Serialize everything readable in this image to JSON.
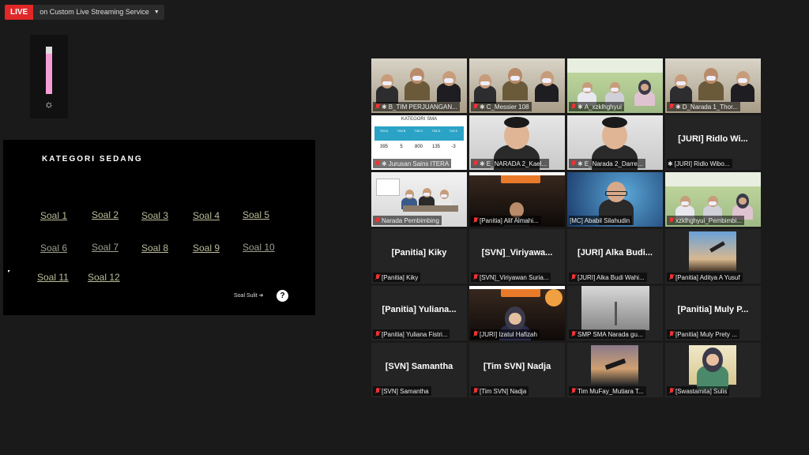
{
  "live": {
    "badge": "LIVE",
    "service": "on Custom Live Streaming Service",
    "caret": "▼"
  },
  "mic": {
    "level_percent": 85,
    "icon": "brightness-icon"
  },
  "share": {
    "title": "KATEGORI SEDANG",
    "questions": [
      "Soal 1",
      "Soal 2",
      "Soal 3",
      "Soal 4",
      "Soal 5",
      "Soal 6",
      "Soal 7",
      "Soal 8",
      "Soal 9",
      "Soal 10",
      "Soal 11",
      "Soal 12"
    ],
    "next_label": "Soal Sulit ➔",
    "help_label": "?"
  },
  "participants": [
    {
      "label": "B_TIM PERJUANGAN...",
      "pinned": true,
      "muted": true,
      "name": "",
      "kind": "video",
      "scene": "room-3people"
    },
    {
      "label": "C_Messier 108",
      "pinned": true,
      "muted": true,
      "name": "",
      "kind": "video",
      "scene": "room-3people"
    },
    {
      "label": "A_xzklhghyui",
      "pinned": true,
      "muted": true,
      "name": "",
      "kind": "video",
      "scene": "room-green"
    },
    {
      "label": "D_Narada 1_Thor...",
      "pinned": true,
      "muted": true,
      "name": "",
      "kind": "video",
      "scene": "room-3people"
    },
    {
      "label": "Jurusan Sains ITERA",
      "pinned": true,
      "muted": true,
      "name": "",
      "kind": "video",
      "scene": "slide-table"
    },
    {
      "label": "E_NARADA 2_Kael...",
      "pinned": true,
      "muted": true,
      "name": "",
      "kind": "video",
      "scene": "face-close"
    },
    {
      "label": "E_Narada 2_Darre...",
      "pinned": true,
      "muted": true,
      "name": "",
      "kind": "video",
      "scene": "face-close"
    },
    {
      "label": "[JURI] Ridlo Wibo...",
      "pinned": true,
      "muted": false,
      "name": "[JURI] Ridlo Wi...",
      "kind": "name"
    },
    {
      "label": "Narada Pembimbing",
      "pinned": false,
      "muted": true,
      "name": "",
      "kind": "video",
      "scene": "classroom"
    },
    {
      "label": "[Panitia] Alif Almahi...",
      "pinned": false,
      "muted": true,
      "name": "",
      "kind": "video",
      "scene": "dark-banner"
    },
    {
      "label": "[MC] Ababil Silahudin",
      "pinned": false,
      "muted": false,
      "name": "",
      "kind": "video",
      "scene": "space-bg",
      "active": true
    },
    {
      "label": "xzklhghyui_Pembimbi...",
      "pinned": false,
      "muted": true,
      "name": "",
      "kind": "video",
      "scene": "room-green"
    },
    {
      "label": "[Panitia] Kiky",
      "pinned": false,
      "muted": true,
      "name": "[Panitia] Kiky",
      "kind": "name"
    },
    {
      "label": "[SVN]_Viriyawan Suria...",
      "pinned": false,
      "muted": true,
      "name": "[SVN]_Viriyawa...",
      "kind": "name"
    },
    {
      "label": "[JURI] Alka Budi Wahi...",
      "pinned": false,
      "muted": true,
      "name": "[JURI] Alka Budi...",
      "kind": "name"
    },
    {
      "label": "[Panitia] Aditya A Yusuf",
      "pinned": false,
      "muted": true,
      "name": "",
      "kind": "photo",
      "scene": "telescope-sky"
    },
    {
      "label": "[Panitia] Yuliana Fistri...",
      "pinned": false,
      "muted": true,
      "name": "[Panitia] Yuliana...",
      "kind": "name"
    },
    {
      "label": "[JURI] Izatul Hafizah",
      "pinned": false,
      "muted": true,
      "name": "",
      "kind": "video",
      "scene": "dark-banner-hijab"
    },
    {
      "label": "SMP SMA Narada gu...",
      "pinned": false,
      "muted": true,
      "name": "",
      "kind": "video",
      "scene": "ceiling"
    },
    {
      "label": "[Panitia] Muly Prety ...",
      "pinned": false,
      "muted": true,
      "name": "[Panitia] Muly P...",
      "kind": "name"
    },
    {
      "label": "[SVN] Samantha",
      "pinned": false,
      "muted": true,
      "name": "[SVN] Samantha",
      "kind": "name"
    },
    {
      "label": "[Tim SVN] Nadja",
      "pinned": false,
      "muted": true,
      "name": "[Tim SVN] Nadja",
      "kind": "name"
    },
    {
      "label": "Tim MuFay_Mutiara T...",
      "pinned": false,
      "muted": true,
      "name": "",
      "kind": "photo",
      "scene": "telescope-dusk"
    },
    {
      "label": "[Swastamita] Sulis",
      "pinned": false,
      "muted": true,
      "name": "",
      "kind": "photo",
      "scene": "hijab-photo"
    }
  ],
  "slide_table": {
    "title": "KATEGORI SMA",
    "headers": [
      "TIM A",
      "TIM B",
      "TIM C",
      "TIM D",
      "TIM E"
    ],
    "values": [
      "395",
      "5",
      "800",
      "135",
      "-3"
    ]
  }
}
